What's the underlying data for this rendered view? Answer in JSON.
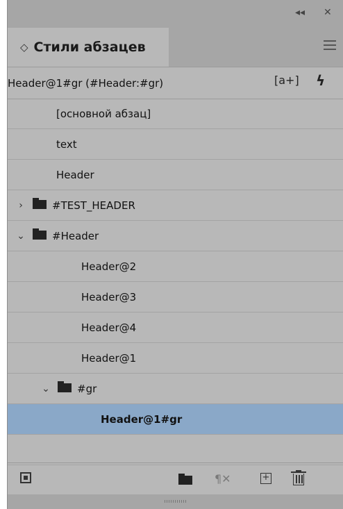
{
  "window": {
    "collapse_glyph": "◂◂",
    "close_glyph": "✕"
  },
  "tab": {
    "arrows_glyph": "◇",
    "title": "Стили абзацев",
    "menu_icon": "hamburger-menu-icon"
  },
  "current_style": {
    "label": "Header@1#gr (#Header:#gr)",
    "new_from_selection_glyph": "[a+]",
    "quick_apply_glyph": "ϟ"
  },
  "styles": [
    {
      "label": "[основной абзац]",
      "level": 0,
      "type": "style"
    },
    {
      "label": "text",
      "level": 0,
      "type": "style"
    },
    {
      "label": "Header",
      "level": 0,
      "type": "style"
    },
    {
      "label": "#TEST_HEADER",
      "level": 0,
      "type": "group",
      "expanded": false
    },
    {
      "label": "#Header",
      "level": 0,
      "type": "group",
      "expanded": true
    },
    {
      "label": "Header@2",
      "level": 1,
      "type": "style"
    },
    {
      "label": "Header@3",
      "level": 1,
      "type": "style"
    },
    {
      "label": "Header@4",
      "level": 1,
      "type": "style"
    },
    {
      "label": "Header@1",
      "level": 1,
      "type": "style"
    },
    {
      "label": "#gr",
      "level": 1,
      "type": "group",
      "expanded": true
    },
    {
      "label": "Header@1#gr",
      "level": 2,
      "type": "style",
      "selected": true
    }
  ],
  "bottom_toolbar": {
    "clear_overrides_glyph": "¶✕",
    "new_style_glyph": "+"
  },
  "colors": {
    "panel_bg": "#b8b8b8",
    "header_bg": "#a6a6a6",
    "selection": "#8aa8c8"
  }
}
